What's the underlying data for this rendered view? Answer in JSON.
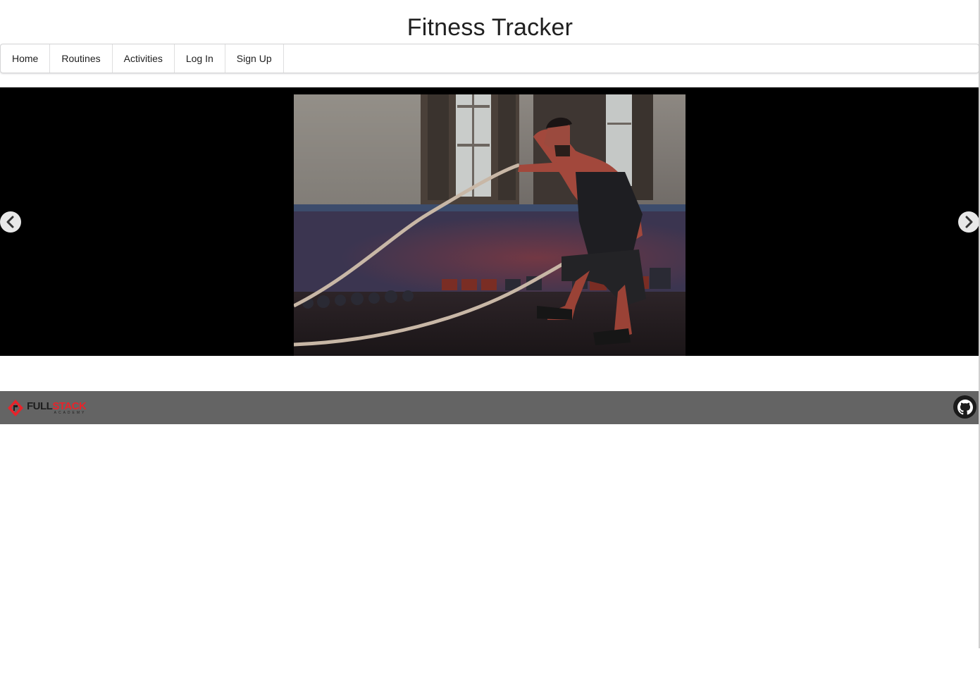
{
  "app": {
    "title": "Fitness Tracker"
  },
  "nav": {
    "items": [
      {
        "label": "Home"
      },
      {
        "label": "Routines"
      },
      {
        "label": "Activities"
      },
      {
        "label": "Log In"
      },
      {
        "label": "Sign Up"
      }
    ]
  },
  "carousel": {
    "prev_icon": "chevron-left-icon",
    "next_icon": "chevron-right-icon",
    "slide": {
      "subject": "man-with-battle-ropes-photo"
    }
  },
  "footer": {
    "logo": {
      "word1": "FULL",
      "word2": "STACK",
      "sub": "ACADEMY"
    },
    "github_icon": "github-icon"
  },
  "colors": {
    "footer_bg": "#646464",
    "carousel_bg": "#000000",
    "logo_accent": "#e8232a"
  }
}
